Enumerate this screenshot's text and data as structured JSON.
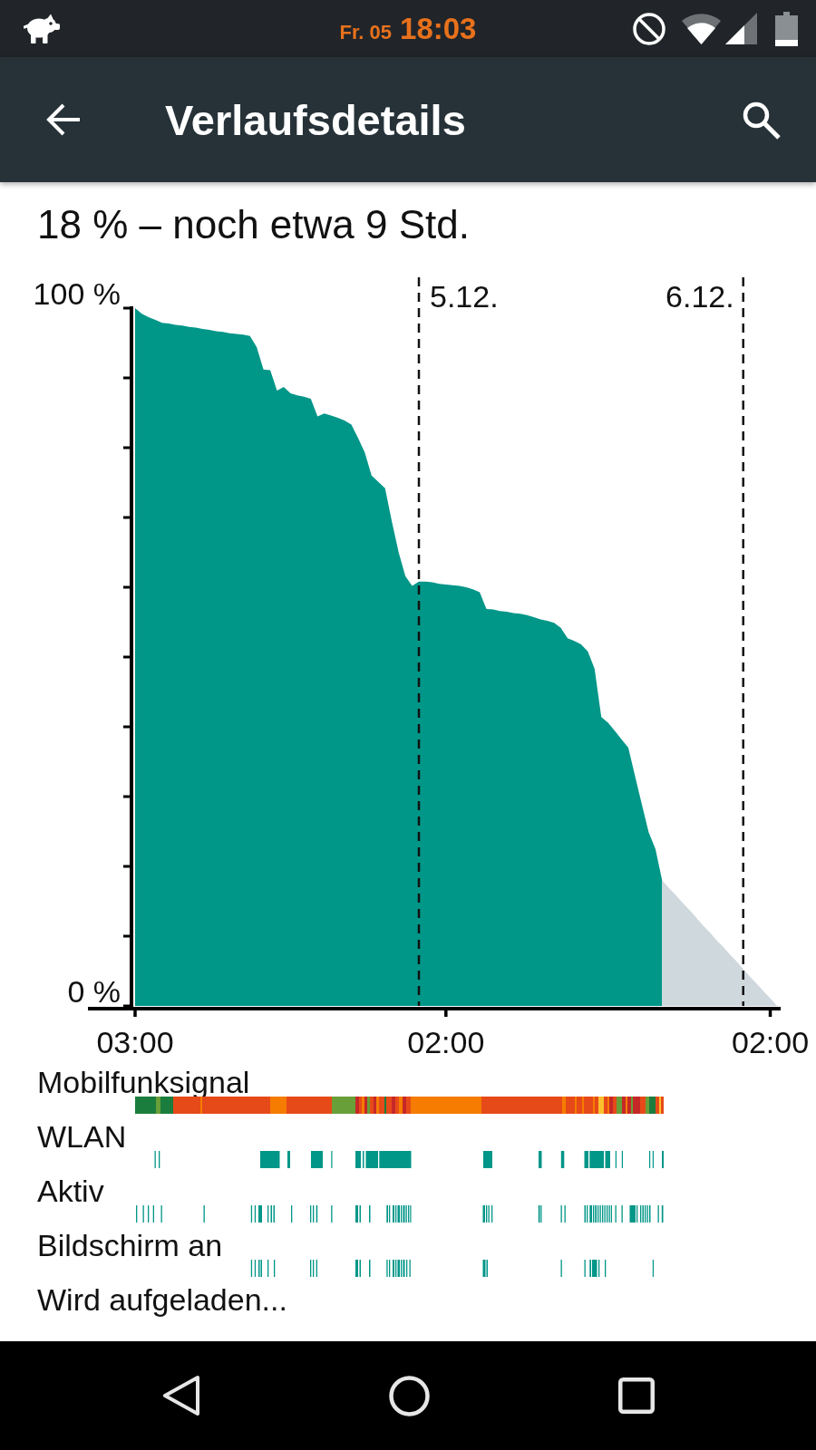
{
  "status_bar": {
    "date": "Fr. 05",
    "time": "18:03"
  },
  "app_bar": {
    "title": "Verlaufsdetails"
  },
  "summary": "18 % – noch etwa 9 Std.",
  "battery_chart": {
    "chart_data": {
      "type": "area",
      "categories": [
        "03:00",
        null,
        null,
        null,
        null,
        null,
        null,
        null,
        null,
        null,
        null,
        null,
        null,
        null,
        null,
        null,
        null,
        null,
        null,
        null,
        null,
        null,
        null,
        null,
        null,
        null,
        null,
        null,
        null,
        null,
        null,
        null,
        null,
        null,
        null,
        null,
        null,
        null,
        null,
        null,
        null,
        null,
        null,
        null,
        null,
        null,
        "02:00",
        null,
        null,
        null,
        null,
        null,
        null,
        null,
        null,
        null,
        null,
        null,
        null,
        null,
        null,
        null,
        null,
        null,
        null,
        null,
        null,
        null,
        null,
        null,
        null,
        null,
        null,
        null,
        null,
        null,
        null,
        null,
        null,
        null,
        null,
        null,
        null,
        null,
        null,
        null,
        null,
        null,
        null,
        null,
        null,
        null,
        null,
        null,
        "02:00",
        null
      ],
      "series": [
        {
          "color": "#009688",
          "values": [
            100,
            99.2,
            98.7,
            98.3,
            97.9,
            97.8,
            97.6,
            97.5,
            97.3,
            97.2,
            97.0,
            96.9,
            96.7,
            96.6,
            96.4,
            96.3,
            96.2,
            96.0,
            94.4,
            91.2,
            91.1,
            88.2,
            88.7,
            87.8,
            87.5,
            87.3,
            87.0,
            84.5,
            84.9,
            84.6,
            84.3,
            83.9,
            83.3,
            81.4,
            79.3,
            76,
            75.1,
            74.2,
            69.4,
            65.0,
            61.6,
            60.2,
            60.8,
            60.8,
            60.7,
            60.5,
            60.4,
            60.3,
            60.2,
            60.0,
            59.7,
            59.3,
            56.9,
            56.8,
            56.6,
            56.5,
            56.3,
            56.2,
            56.0,
            55.7,
            55.4,
            55.2,
            54.9,
            54.2,
            52.7,
            52.3,
            51.8,
            50.8,
            48.3,
            41.4,
            40.6,
            39.4,
            38.2,
            37.0,
            32.9,
            28.9,
            24.9,
            22.5,
            18,
            null,
            null,
            null,
            null,
            null,
            null,
            null,
            null,
            null,
            null,
            null,
            null,
            null,
            null,
            null,
            null,
            null
          ]
        },
        {
          "color": "#cfd8dc",
          "values": [
            null,
            null,
            null,
            null,
            null,
            null,
            null,
            null,
            null,
            null,
            null,
            null,
            null,
            null,
            null,
            null,
            null,
            null,
            null,
            null,
            null,
            null,
            null,
            null,
            null,
            null,
            null,
            null,
            null,
            null,
            null,
            null,
            null,
            null,
            null,
            null,
            null,
            null,
            null,
            null,
            null,
            null,
            null,
            null,
            null,
            null,
            null,
            null,
            null,
            null,
            null,
            null,
            null,
            null,
            null,
            null,
            null,
            null,
            null,
            null,
            null,
            null,
            null,
            null,
            null,
            null,
            null,
            null,
            null,
            null,
            null,
            null,
            null,
            null,
            null,
            null,
            null,
            null,
            18,
            16.9,
            15.9,
            14.8,
            13.8,
            12.7,
            11.6,
            10.6,
            9.5,
            8.5,
            7.4,
            6.4,
            5.3,
            4.2,
            3.2,
            2.1,
            1.1,
            0
          ]
        }
      ],
      "ylim": [
        0,
        100
      ],
      "yticks": [
        {
          "value": 0,
          "label": "0 %"
        },
        {
          "value": 100,
          "label": "100 %"
        }
      ],
      "annotations": [
        "5.12.",
        "6.12."
      ]
    }
  },
  "tracks": [
    {
      "label": "Mobilfunksignal",
      "kind": "signal"
    },
    {
      "label": "WLAN",
      "kind": "wlan"
    },
    {
      "label": "Aktiv",
      "kind": "active"
    },
    {
      "label": "Bildschirm an",
      "kind": "screen"
    },
    {
      "label": "Wird aufgeladen...",
      "kind": "charging"
    }
  ]
}
